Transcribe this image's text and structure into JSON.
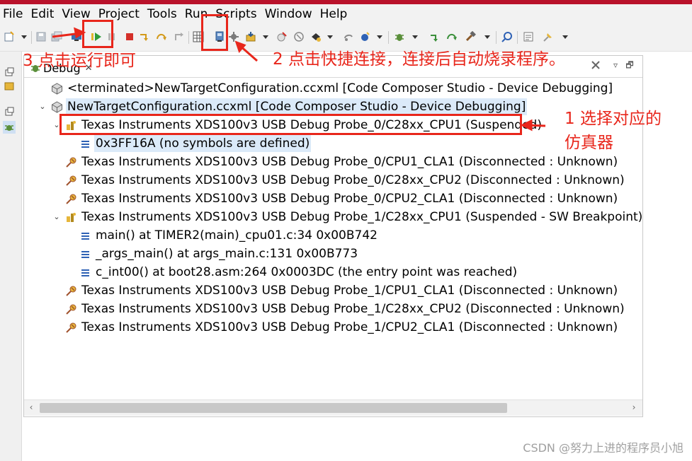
{
  "menubar": {
    "items": [
      "File",
      "Edit",
      "View",
      "Project",
      "Tools",
      "Run",
      "Scripts",
      "Window",
      "Help"
    ]
  },
  "toolbar": {
    "icons": [
      "new-icon",
      "save-icon",
      "save-all-icon",
      "connect-target-icon",
      "resume-icon",
      "suspend-icon",
      "terminate-icon",
      "step-into-icon",
      "step-over-icon",
      "step-return-icon",
      "registers-icon",
      "quick-connect-icon",
      "load-program-icon",
      "load-symbols-icon",
      "restart-icon",
      "reset-icon",
      "breakpoint-icon",
      "debug-icon",
      "build-icon",
      "search-icon",
      "console-icon",
      "pin-icon"
    ]
  },
  "debug_view": {
    "tab_label": "Debug",
    "close_glyph": "✕",
    "minimize_glyph": "▿",
    "maximize_glyph": "🗗",
    "rows": [
      {
        "indent": 0,
        "twisty": "",
        "icon": "target-config-icon",
        "text": "<terminated>NewTargetConfiguration.ccxml [Code Composer Studio - Device Debugging]",
        "selected": false
      },
      {
        "indent": 0,
        "twisty": "v",
        "icon": "target-config-icon",
        "text": "NewTargetConfiguration.ccxml [Code Composer Studio - Device Debugging]",
        "selected": true
      },
      {
        "indent": 1,
        "twisty": "v",
        "icon": "suspended-core-icon",
        "text": "Texas Instruments XDS100v3 USB Debug Probe_0/C28xx_CPU1 (Suspended)",
        "selected": false
      },
      {
        "indent": 2,
        "twisty": "",
        "icon": "stack-frame-icon",
        "text": "0x3FF16A  (no symbols are defined)",
        "selected": true
      },
      {
        "indent": 1,
        "twisty": "",
        "icon": "disconnected-core-icon",
        "text": "Texas Instruments XDS100v3 USB Debug Probe_0/CPU1_CLA1 (Disconnected : Unknown)",
        "selected": false
      },
      {
        "indent": 1,
        "twisty": "",
        "icon": "disconnected-core-icon",
        "text": "Texas Instruments XDS100v3 USB Debug Probe_0/C28xx_CPU2 (Disconnected : Unknown)",
        "selected": false
      },
      {
        "indent": 1,
        "twisty": "",
        "icon": "disconnected-core-icon",
        "text": "Texas Instruments XDS100v3 USB Debug Probe_0/CPU2_CLA1 (Disconnected : Unknown)",
        "selected": false
      },
      {
        "indent": 1,
        "twisty": "v",
        "icon": "suspended-core-icon",
        "text": "Texas Instruments XDS100v3 USB Debug Probe_1/C28xx_CPU1 (Suspended - SW Breakpoint)",
        "selected": false
      },
      {
        "indent": 2,
        "twisty": "",
        "icon": "stack-frame-icon",
        "text": "main() at TIMER2(main)_cpu01.c:34 0x00B742",
        "selected": false
      },
      {
        "indent": 2,
        "twisty": "",
        "icon": "stack-frame-icon",
        "text": "_args_main() at args_main.c:131 0x00B773",
        "selected": false
      },
      {
        "indent": 2,
        "twisty": "",
        "icon": "stack-frame-icon",
        "text": "c_int00() at boot28.asm:264 0x0003DC  (the entry point was reached)",
        "selected": false
      },
      {
        "indent": 1,
        "twisty": "",
        "icon": "disconnected-core-icon",
        "text": "Texas Instruments XDS100v3 USB Debug Probe_1/CPU1_CLA1 (Disconnected : Unknown)",
        "selected": false
      },
      {
        "indent": 1,
        "twisty": "",
        "icon": "disconnected-core-icon",
        "text": "Texas Instruments XDS100v3 USB Debug Probe_1/C28xx_CPU2 (Disconnected : Unknown)",
        "selected": false
      },
      {
        "indent": 1,
        "twisty": "",
        "icon": "disconnected-core-icon",
        "text": "Texas Instruments XDS100v3 USB Debug Probe_1/CPU2_CLA1 (Disconnected : Unknown)",
        "selected": false
      }
    ],
    "scroll_left": "‹",
    "scroll_right": "›"
  },
  "annotations": {
    "step1_line1": "1 选择对应的",
    "step1_line2": "仿真器",
    "step2": "2 点击快捷连接，连接后自动烧录程序。",
    "step3": "3 点击运行即可",
    "color": "#e8261b"
  },
  "watermark": "CSDN @努力上进的程序员小旭"
}
